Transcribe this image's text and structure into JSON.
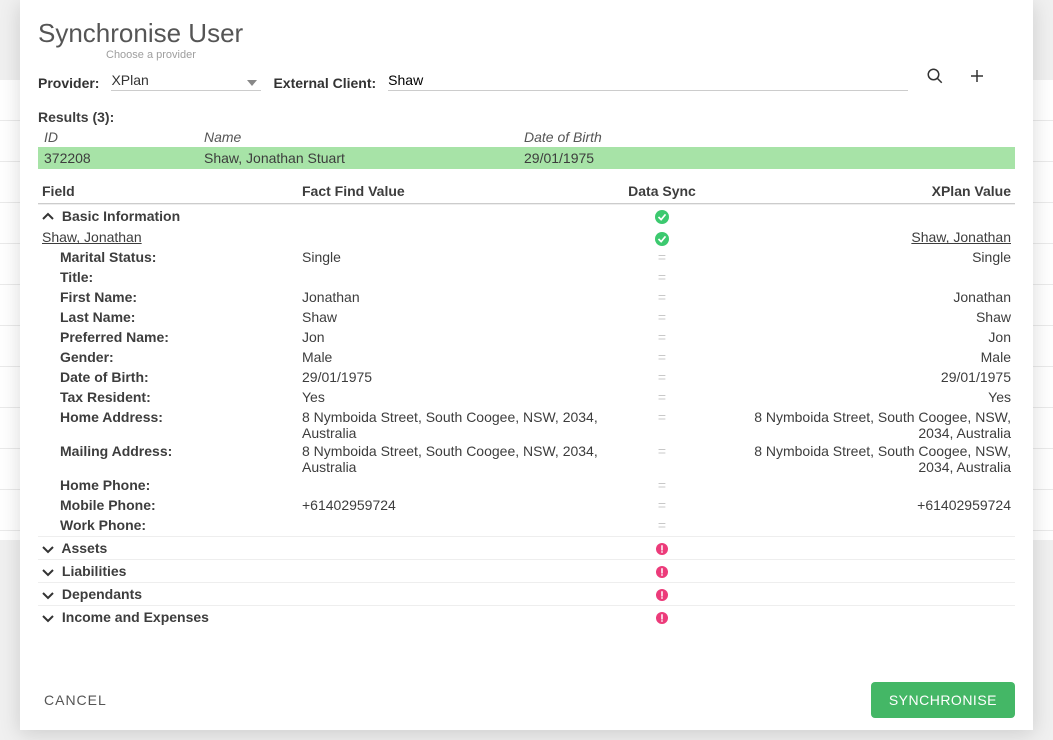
{
  "title": "Synchronise User",
  "provider": {
    "label": "Provider:",
    "hint": "Choose a provider",
    "value": "XPlan"
  },
  "external": {
    "label": "External Client:",
    "value": "Shaw"
  },
  "results_label": "Results (3):",
  "results_headers": {
    "id": "ID",
    "name": "Name",
    "dob": "Date of Birth"
  },
  "results_row": {
    "id": "372208",
    "name": "Shaw, Jonathan Stuart",
    "dob": "29/01/1975"
  },
  "grid_headers": {
    "field": "Field",
    "ffv": "Fact Find Value",
    "sync": "Data Sync",
    "xplan": "XPlan Value"
  },
  "sections": {
    "basic": {
      "label": "Basic Information"
    },
    "assets": {
      "label": "Assets"
    },
    "liabilities": {
      "label": "Liabilities"
    },
    "dependants": {
      "label": "Dependants"
    },
    "income": {
      "label": "Income and Expenses"
    }
  },
  "person_link": {
    "left": "Shaw, Jonathan",
    "right": "Shaw, Jonathan"
  },
  "fields": [
    {
      "label": "Marital Status:",
      "ffv": "Single",
      "xplan": "Single"
    },
    {
      "label": "Title:",
      "ffv": "",
      "xplan": ""
    },
    {
      "label": "First Name:",
      "ffv": "Jonathan",
      "xplan": "Jonathan"
    },
    {
      "label": "Last Name:",
      "ffv": "Shaw",
      "xplan": "Shaw"
    },
    {
      "label": "Preferred Name:",
      "ffv": "Jon",
      "xplan": "Jon"
    },
    {
      "label": "Gender:",
      "ffv": "Male",
      "xplan": "Male"
    },
    {
      "label": "Date of Birth:",
      "ffv": "29/01/1975",
      "xplan": "29/01/1975"
    },
    {
      "label": "Tax Resident:",
      "ffv": "Yes",
      "xplan": "Yes"
    },
    {
      "label": "Home Address:",
      "ffv": "8 Nymboida Street, South Coogee, NSW, 2034, Australia",
      "xplan": "8 Nymboida Street, South Coogee, NSW, 2034, Australia"
    },
    {
      "label": "Mailing Address:",
      "ffv": "8 Nymboida Street, South Coogee, NSW, 2034, Australia",
      "xplan": "8 Nymboida Street, South Coogee, NSW, 2034, Australia"
    },
    {
      "label": "Home Phone:",
      "ffv": "",
      "xplan": ""
    },
    {
      "label": "Mobile Phone:",
      "ffv": "+61402959724",
      "xplan": "+61402959724"
    },
    {
      "label": "Work Phone:",
      "ffv": "",
      "xplan": ""
    }
  ],
  "buttons": {
    "cancel": "CANCEL",
    "sync": "SYNCHRONISE"
  },
  "glyphs": {
    "eq": "="
  }
}
